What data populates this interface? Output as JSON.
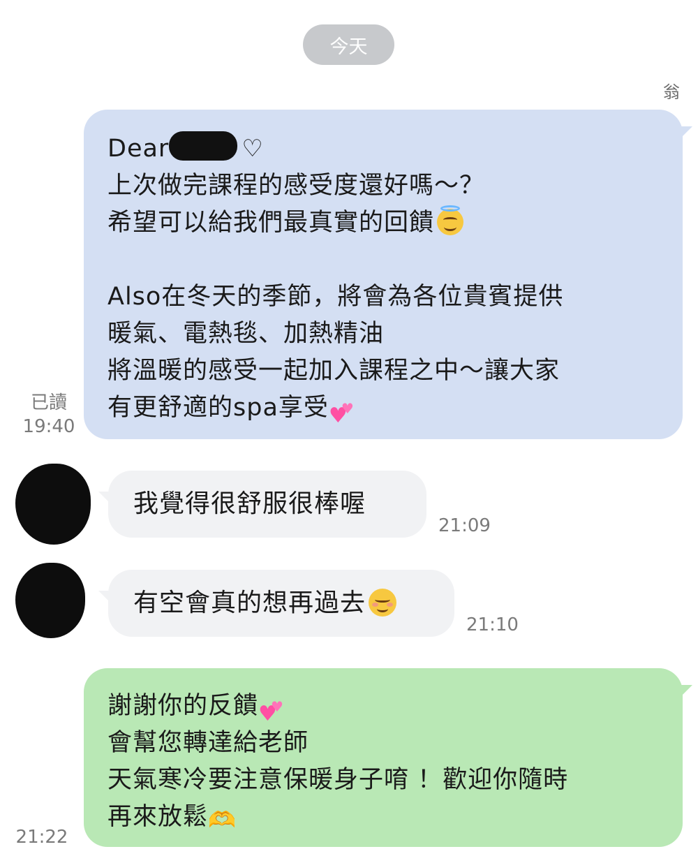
{
  "date_divider": "今天",
  "sender_name": "翁",
  "messages": {
    "out1": {
      "greeting": "Dear",
      "line1": "上次做完課程的感受度還好嗎～？",
      "line2": "希望可以給我們最真實的回饋",
      "line3": "Also在冬天的季節，將會為各位貴賓提供",
      "line4": "暖氣、電熱毯、加熱精油",
      "line5": "將溫暖的感受一起加入課程之中～讓大家",
      "line6": "有更舒適的spa享受",
      "read_label": "已讀",
      "time": "19:40"
    },
    "in1": {
      "text": "我覺得很舒服很棒喔",
      "time": "21:09"
    },
    "in2": {
      "text": "有空會真的想再過去",
      "time": "21:10"
    },
    "out2": {
      "line1": "謝謝你的反饋",
      "line2": "會幫您轉達給老師",
      "line3": "天氣寒冷要注意保暖身子唷 ！歡迎你隨時",
      "line4": "再來放鬆",
      "time": "21:22"
    }
  },
  "icons": {
    "heart_outline": "♡",
    "hand_heart": "🫶",
    "angel_face": "smiling-face-with-halo-icon",
    "two_hearts": "two-hearts-icon",
    "relieved_face": "smiling-face-icon"
  },
  "colors": {
    "outgoing_blue": "#d4dff3",
    "outgoing_green": "#b9e8b5",
    "incoming_grey": "#f1f2f4",
    "date_pill": "#c7c9cc"
  }
}
